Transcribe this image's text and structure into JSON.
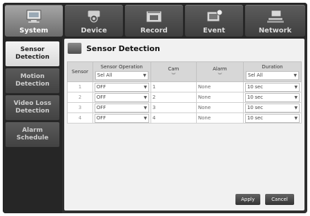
{
  "tabs": [
    {
      "label": "System",
      "icon": "system-icon",
      "active": true
    },
    {
      "label": "Device",
      "icon": "camera-icon",
      "active": false
    },
    {
      "label": "Record",
      "icon": "record-icon",
      "active": false
    },
    {
      "label": "Event",
      "icon": "event-icon",
      "active": false
    },
    {
      "label": "Network",
      "icon": "network-icon",
      "active": false
    }
  ],
  "menu": [
    {
      "label": "Sensor Detection",
      "active": true
    },
    {
      "label": "Motion Detection",
      "active": false
    },
    {
      "label": "Video Loss Detection",
      "active": false
    },
    {
      "label": "Alarm Schedule",
      "active": false
    }
  ],
  "page": {
    "title": "Sensor Detection"
  },
  "table": {
    "headers": {
      "sensor": "Sensor",
      "operation": "Sensor Operation",
      "cam": "Cam",
      "alarm": "Alarm",
      "duration": "Duration"
    },
    "header_selects": {
      "operation": "Sel All",
      "duration": "Sel All"
    },
    "rows": [
      {
        "sensor": "1",
        "operation": "OFF",
        "cam": "1",
        "alarm": "None",
        "duration": "10 sec"
      },
      {
        "sensor": "2",
        "operation": "OFF",
        "cam": "2",
        "alarm": "None",
        "duration": "10 sec"
      },
      {
        "sensor": "3",
        "operation": "OFF",
        "cam": "3",
        "alarm": "None",
        "duration": "10 sec"
      },
      {
        "sensor": "4",
        "operation": "OFF",
        "cam": "4",
        "alarm": "None",
        "duration": "10 sec"
      }
    ]
  },
  "buttons": {
    "apply": "Apply",
    "cancel": "Cancel"
  },
  "colors": {
    "active_tab": "#9a9a9a",
    "inactive_tab": "#4a4a4a",
    "menu_active": "#e8e8e8",
    "content_bg": "#f1f1f1"
  }
}
